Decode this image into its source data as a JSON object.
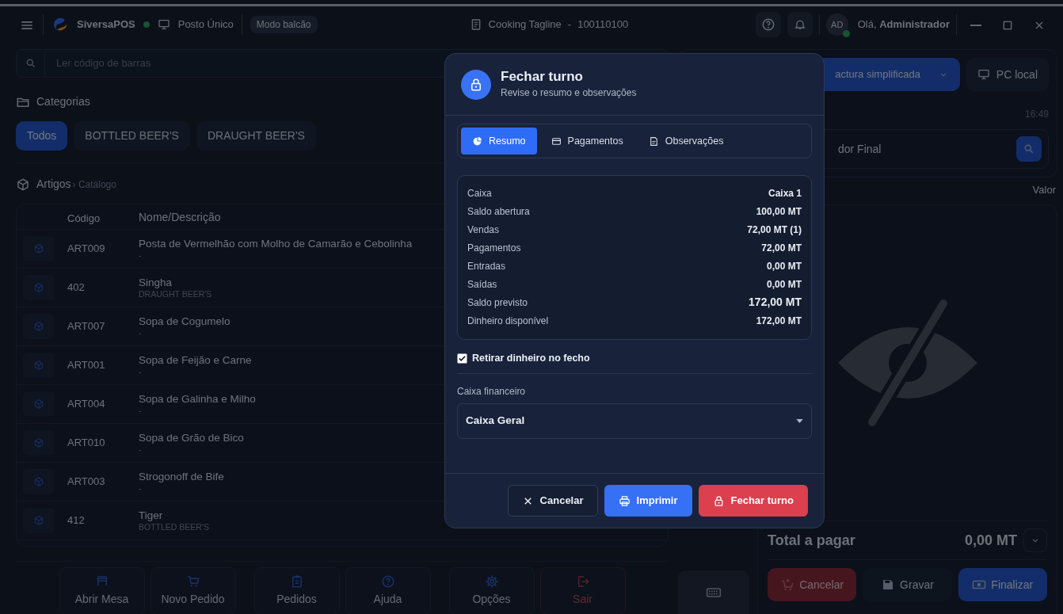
{
  "titlebar": {
    "app_name": "SiversaPOS",
    "online": true,
    "station": "Posto Único",
    "mode_badge": "Modo balcão",
    "document": "Cooking Tagline",
    "separator": "-",
    "document_number": "100110100",
    "avatar_initials": "AD",
    "user_online": true,
    "greeting": "Olá, **Administrador**"
  },
  "search": {
    "placeholder": "Ler código de barras"
  },
  "categories": {
    "title": "Categorias",
    "items": [
      {
        "label": "Todos",
        "selected": true
      },
      {
        "label": "BOTTLED BEER'S",
        "selected": false
      },
      {
        "label": "DRAUGHT BEER'S",
        "selected": false
      }
    ]
  },
  "articles": {
    "title": "Artigos",
    "breadcrumb": "› Catálogo",
    "columns": [
      "Código",
      "Nome/Descrição"
    ],
    "rows": [
      {
        "code": "ART009",
        "name": "Posta de Vermelhão com Molho de Camarão e Cebolinha",
        "category": "-"
      },
      {
        "code": "402",
        "name": "Singha",
        "category": "DRAUGHT BEER'S"
      },
      {
        "code": "ART007",
        "name": "Sopa de Cogumelo",
        "category": "-"
      },
      {
        "code": "ART001",
        "name": "Sopa de Feijão e Carne",
        "category": "-"
      },
      {
        "code": "ART004",
        "name": "Sopa de Galinha e Milho",
        "category": "-"
      },
      {
        "code": "ART010",
        "name": "Sopa de Grão de Bico",
        "category": "-"
      },
      {
        "code": "ART003",
        "name": "Strogonoff de Bife",
        "category": "-"
      },
      {
        "code": "412",
        "name": "Tiger",
        "category": "BOTTLED BEER'S"
      }
    ]
  },
  "toolbar": [
    {
      "label": "Abrir Mesa",
      "kind": "normal"
    },
    {
      "label": "Novo Pedido",
      "kind": "normal"
    },
    {
      "label": "Pedidos",
      "kind": "normal"
    },
    {
      "label": "Ajuda",
      "kind": "normal"
    },
    {
      "label": "Opções",
      "kind": "normal"
    },
    {
      "label": "Sair",
      "kind": "danger"
    }
  ],
  "sale": {
    "doc_type": "actura simplificada",
    "terminal": "PC local",
    "time": "16:49",
    "customer": "dor Final",
    "value_column": "Valor",
    "total_label": "Total a pagar",
    "total": "0,00 MT",
    "actions": [
      {
        "label": "Cancelar",
        "kind": "danger"
      },
      {
        "label": "Gravar",
        "kind": "secondary"
      },
      {
        "label": "Finalizar",
        "kind": "primary"
      }
    ]
  },
  "modal": {
    "title": "Fechar turno",
    "subtitle": "Revise o resumo e observações",
    "tabs": [
      {
        "label": "Resumo",
        "selected": true
      },
      {
        "label": "Pagamentos",
        "selected": false
      },
      {
        "label": "Observações",
        "selected": false
      }
    ],
    "summary": [
      {
        "label": "Caixa",
        "value": "Caixa 1",
        "emphasis": false
      },
      {
        "label": "Saldo abertura",
        "value": "100,00 MT",
        "emphasis": false
      },
      {
        "label": "Vendas",
        "value": "72,00 MT (1)",
        "emphasis": false
      },
      {
        "label": "Pagamentos",
        "value": "72,00 MT",
        "emphasis": false
      },
      {
        "label": "Entradas",
        "value": "0,00 MT",
        "emphasis": false
      },
      {
        "label": "Saídas",
        "value": "0,00 MT",
        "emphasis": false
      },
      {
        "label": "Saldo previsto",
        "value": "172,00 MT",
        "emphasis": true
      },
      {
        "label": "Dinheiro disponível",
        "value": "172,00 MT",
        "emphasis": false
      }
    ],
    "withdraw_cash": {
      "label": "Retirar dinheiro no fecho",
      "checked": true
    },
    "cash_account": {
      "label": "Caixa financeiro",
      "value": "Caixa Geral"
    },
    "buttons": [
      {
        "label": "Cancelar",
        "kind": "secondary"
      },
      {
        "label": "Imprimir",
        "kind": "primary"
      },
      {
        "label": "Fechar turno",
        "kind": "danger"
      }
    ]
  }
}
